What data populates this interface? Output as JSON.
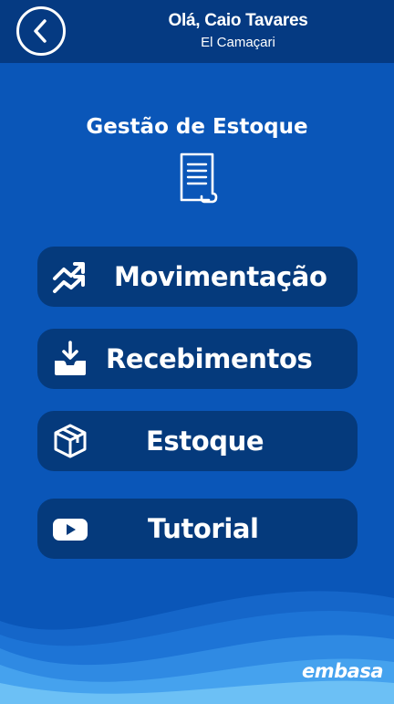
{
  "header": {
    "greeting": "Olá, Caio Tavares",
    "unit": "El Camaçari",
    "back_icon": "chevron-left-icon"
  },
  "page": {
    "title": "Gestão de Estoque",
    "title_icon": "document-icon"
  },
  "menu": [
    {
      "label": "Movimentação",
      "icon": "trending-arrows-icon"
    },
    {
      "label": "Recebimentos",
      "icon": "inbox-download-icon"
    },
    {
      "label": "Estoque",
      "icon": "box-icon"
    },
    {
      "label": "Tutorial",
      "icon": "youtube-play-icon"
    }
  ],
  "footer": {
    "logo": "embasa"
  },
  "colors": {
    "background": "#0a56b8",
    "header": "#053a82",
    "button": "#053a7c",
    "text": "#ffffff"
  }
}
